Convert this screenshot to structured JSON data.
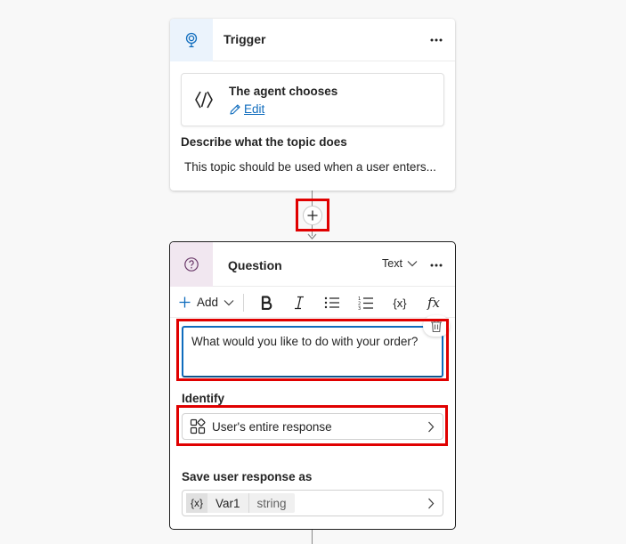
{
  "trigger": {
    "title": "Trigger",
    "agent_title": "The agent chooses",
    "edit_label": "Edit",
    "description_label": "Describe what the topic does",
    "description_text": "This topic should be used when a user enters..."
  },
  "question": {
    "title": "Question",
    "type_value": "Text",
    "add_label": "Add",
    "variable_glyph": "{x}",
    "formula_glyph": "fx",
    "message": "What would you like to do with your order?",
    "identify_label": "Identify",
    "identify_value": "User's entire response",
    "save_label": "Save user response as",
    "var_glyph": "{x}",
    "var_name": "Var1",
    "var_type": "string"
  },
  "colors": {
    "accent": "#0f6cbd",
    "highlight": "#e00000",
    "question_tile": "#f1e7f0",
    "trigger_tile": "#ebf3fc"
  },
  "icons": [
    "trigger-icon",
    "more-icon",
    "agent-icon",
    "edit-icon",
    "add-node-icon",
    "question-icon",
    "chevron-down-icon",
    "plus-icon",
    "bold-icon",
    "italic-icon",
    "bullet-list-icon",
    "numbered-list-icon",
    "variable-icon",
    "formula-icon",
    "trash-icon",
    "entity-icon",
    "chevron-right-icon"
  ]
}
